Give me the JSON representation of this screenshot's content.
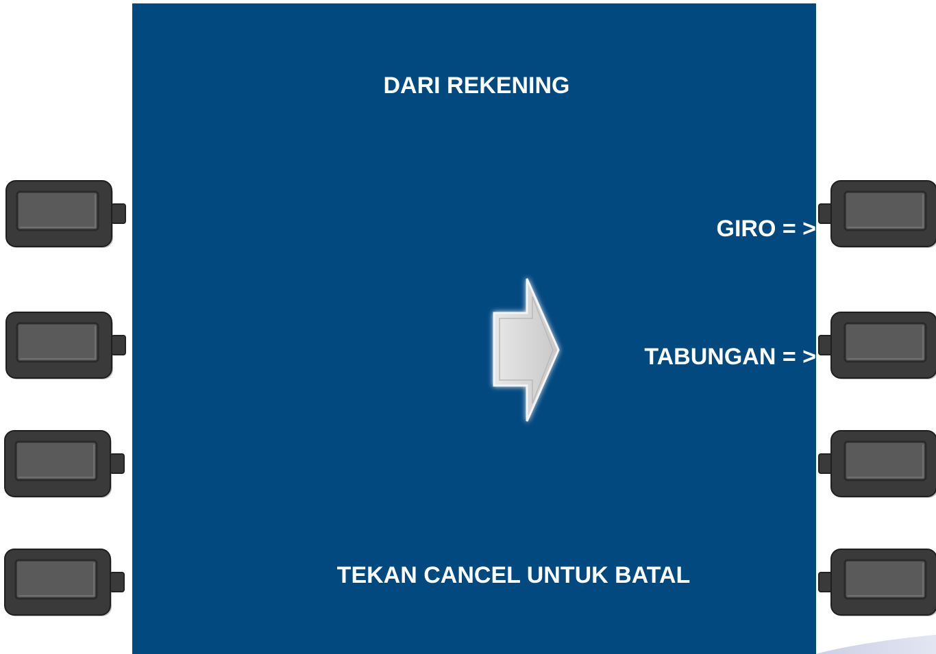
{
  "screen": {
    "title": "DARI REKENING",
    "options": {
      "giro": "GIRO = >",
      "tabungan": "TABUNGAN = >"
    },
    "cancel_text": "TEKAN CANCEL UNTUK BATAL"
  },
  "colors": {
    "screen_background": "#024980",
    "text": "#ffffff",
    "button_body": "#3a3a3a",
    "button_face": "#5a5a5a",
    "arrow_fill": "#d6d6d6"
  },
  "icons": {
    "center_arrow": "right-arrow-icon",
    "fdk_buttons": "atm-side-button"
  }
}
